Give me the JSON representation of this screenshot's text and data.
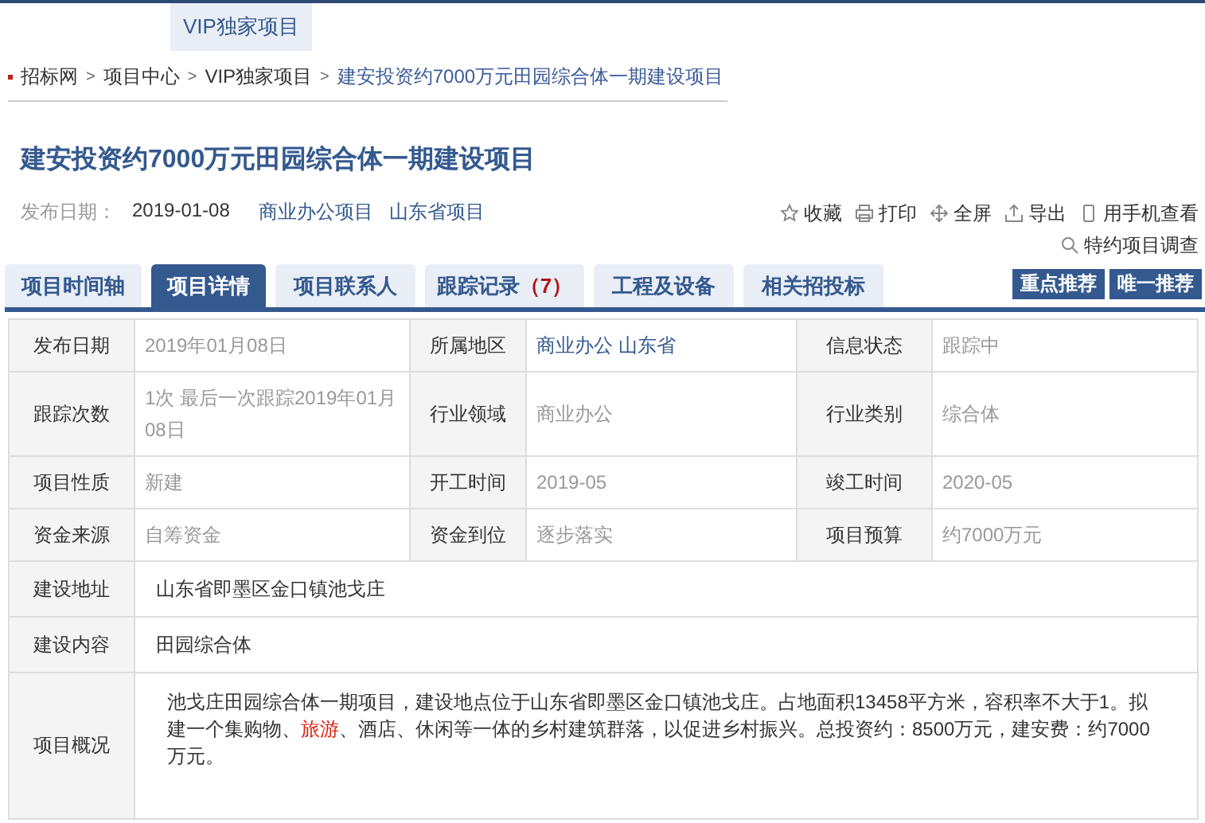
{
  "top_nav": {
    "items": [
      {
        "label": "VIP独家项目",
        "selected": true
      }
    ]
  },
  "breadcrumb": {
    "separator": ">",
    "items": [
      "招标网",
      "项目中心",
      "VIP独家项目",
      "建安投资约7000万元田园综合体一期建设项目"
    ]
  },
  "title": "建安投资约7000万元田园综合体一期建设项目",
  "meta": {
    "date_label": "发布日期：",
    "date": "2019-01-08",
    "tags": [
      "商业办公项目",
      "山东省项目"
    ]
  },
  "actions": [
    {
      "kind": "star",
      "label": "收藏"
    },
    {
      "kind": "print",
      "label": "打印"
    },
    {
      "kind": "move",
      "label": "全屏"
    },
    {
      "kind": "export",
      "label": "导出"
    },
    {
      "kind": "phone",
      "label": "用手机查看"
    },
    {
      "kind": "search",
      "label": "特约项目调查"
    }
  ],
  "tabs": [
    {
      "label": "项目时间轴",
      "selected": false
    },
    {
      "label": "项目详情",
      "selected": true
    },
    {
      "label": "项目联系人",
      "selected": false
    },
    {
      "label": "跟踪记录",
      "count": "（7）",
      "selected": false
    },
    {
      "label": "工程及设备",
      "selected": false
    },
    {
      "label": "相关招投标",
      "selected": false
    }
  ],
  "badges": [
    "重点推荐",
    "唯一推荐"
  ],
  "details": {
    "grid_rows": [
      [
        {
          "label": "发布日期",
          "value": "2019年01月08日"
        },
        {
          "label": "所属地区",
          "value": "商业办公 山东省",
          "link": true
        },
        {
          "label": "信息状态",
          "value": "跟踪中"
        }
      ],
      [
        {
          "label": "跟踪次数",
          "value": "1次 最后一次跟踪2019年01月08日"
        },
        {
          "label": "行业领域",
          "value": "商业办公"
        },
        {
          "label": "行业类别",
          "value": "综合体"
        }
      ],
      [
        {
          "label": "项目性质",
          "value": "新建"
        },
        {
          "label": "开工时间",
          "value": "2019-05"
        },
        {
          "label": "竣工时间",
          "value": "2020-05"
        }
      ],
      [
        {
          "label": "资金来源",
          "value": "自筹资金"
        },
        {
          "label": "资金到位",
          "value": "逐步落实"
        },
        {
          "label": "项目预算",
          "value": "约7000万元"
        }
      ]
    ],
    "wide_rows": [
      {
        "label": "建设地址",
        "value": "山东省即墨区金口镇池戈庄"
      },
      {
        "label": "建设内容",
        "value": "田园综合体"
      }
    ],
    "summary": {
      "label": "项目概况",
      "segments": [
        {
          "text": "池戈庄田园综合体一期项目，建设地点位于山东省即墨区金口镇池戈庄。占地面积13458平方米，容积率不大于1。拟建一个集购物、",
          "highlighted": false
        },
        {
          "text": "旅游",
          "highlighted": true
        },
        {
          "text": "、酒店、休闲等一体的乡村建筑群落，以促进乡村振兴。总投资约：8500万元，建安费：约7000万元。",
          "highlighted": false
        }
      ]
    }
  }
}
